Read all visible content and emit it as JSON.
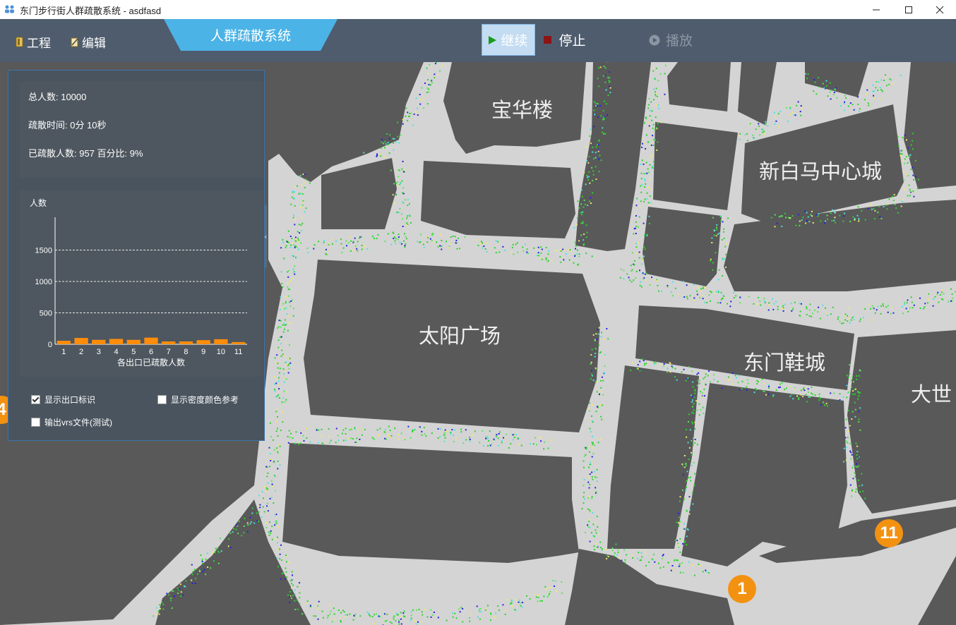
{
  "window": {
    "title": "东门步行街人群疏散系统 - asdfasd",
    "controls": [
      "minimize-icon",
      "maximize-icon",
      "close-icon"
    ]
  },
  "toolbar": {
    "menu": [
      {
        "label": "工程",
        "icon": "project-icon"
      },
      {
        "label": "编辑",
        "icon": "edit-icon"
      }
    ],
    "tab_label": "人群疏散系统",
    "continue_label": "继续",
    "stop_label": "停止",
    "play_label": "播放"
  },
  "stats": {
    "total": "总人数:  10000",
    "time": "疏散时间:  0分 10秒",
    "evacuated": "已疏散人数: 957  百分比: 9%"
  },
  "options": {
    "show_exit": "显示出口标识",
    "show_density": "显示密度颜色参考",
    "export_vrs": "输出vrs文件(测试)",
    "show_exit_checked": true,
    "show_density_checked": false,
    "export_vrs_checked": false
  },
  "collapse_label": "‹‹",
  "map": {
    "labels": [
      "宝华楼",
      "新白马中心城",
      "太阳广场",
      "东门鞋城",
      "大世"
    ],
    "exits": [
      "1",
      "11",
      "4"
    ]
  },
  "chart_data": {
    "type": "bar",
    "ylabel": "人数",
    "xlabel": "各出口已疏散人数",
    "categories": [
      "1",
      "2",
      "3",
      "4",
      "5",
      "6",
      "7",
      "8",
      "9",
      "10",
      "11"
    ],
    "values": [
      55,
      100,
      70,
      85,
      70,
      105,
      45,
      45,
      65,
      80,
      35
    ],
    "ylim": [
      0,
      2000
    ],
    "yticks": [
      "0",
      "500",
      "1000",
      "1500"
    ],
    "bar_color": "#ff8c0a",
    "grid": true
  }
}
